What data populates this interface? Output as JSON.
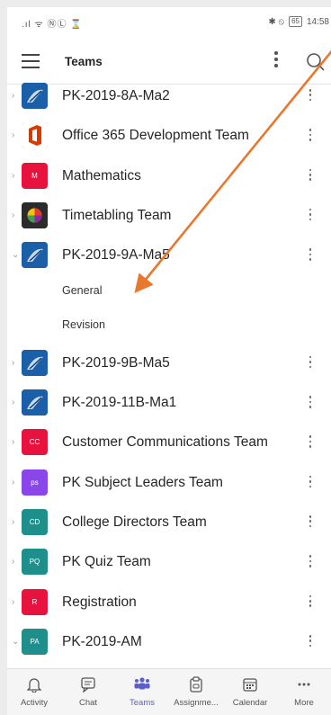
{
  "status_bar": {
    "time": "14:58",
    "battery": "65",
    "left_icons": ".ıl ᯤ ⓃⓁ ⌛",
    "right_icons": "✱ ⦸"
  },
  "header": {
    "title": "Teams"
  },
  "teams": [
    {
      "name": "PK-2019-8A-Ma2",
      "avatar_text": "",
      "avatar_color": "#1a5fa8",
      "expanded": false
    },
    {
      "name": "Office 365 Development Team",
      "avatar_text": "",
      "avatar_color": "#d83b01",
      "expanded": false
    },
    {
      "name": "Mathematics",
      "avatar_text": "M",
      "avatar_color": "#e8123e",
      "expanded": false
    },
    {
      "name": "Timetabling Team",
      "avatar_text": "",
      "avatar_color": "#2b2b2b",
      "expanded": false
    },
    {
      "name": "PK-2019-9A-Ma5",
      "avatar_text": "",
      "avatar_color": "#1a5fa8",
      "expanded": true,
      "channels": [
        "General",
        "Revision"
      ]
    },
    {
      "name": "PK-2019-9B-Ma5",
      "avatar_text": "",
      "avatar_color": "#1a5fa8",
      "expanded": false
    },
    {
      "name": "PK-2019-11B-Ma1",
      "avatar_text": "",
      "avatar_color": "#1a5fa8",
      "expanded": false
    },
    {
      "name": "Customer Communications Team",
      "avatar_text": "CC",
      "avatar_color": "#e8123e",
      "expanded": false
    },
    {
      "name": "PK Subject Leaders Team",
      "avatar_text": "ps",
      "avatar_color": "#8a46e8",
      "expanded": false
    },
    {
      "name": "College Directors Team",
      "avatar_text": "CD",
      "avatar_color": "#1e8f8a",
      "expanded": false
    },
    {
      "name": "PK Quiz Team",
      "avatar_text": "PQ",
      "avatar_color": "#1e8f8a",
      "expanded": false
    },
    {
      "name": "Registration",
      "avatar_text": "R",
      "avatar_color": "#e8123e",
      "expanded": false
    },
    {
      "name": "PK-2019-AM",
      "avatar_text": "PA",
      "avatar_color": "#1e8f8a",
      "expanded": true
    }
  ],
  "tabs": [
    {
      "label": "Activity",
      "icon": "bell-icon",
      "active": false
    },
    {
      "label": "Chat",
      "icon": "chat-icon",
      "active": false
    },
    {
      "label": "Teams",
      "icon": "teams-icon",
      "active": true
    },
    {
      "label": "Assignme...",
      "icon": "assignments-icon",
      "active": false
    },
    {
      "label": "Calendar",
      "icon": "calendar-icon",
      "active": false
    },
    {
      "label": "More",
      "icon": "more-icon",
      "active": false
    }
  ],
  "colors": {
    "accent": "#5b5fc7",
    "annotation_arrow": "#e9772e"
  }
}
